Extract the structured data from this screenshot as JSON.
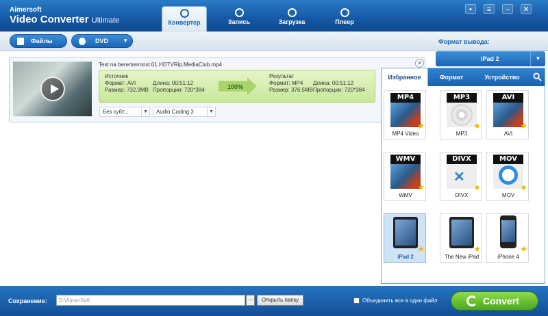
{
  "header": {
    "brand_line1": "Aimersoft",
    "brand_line2": "Video Converter",
    "brand_line2_suffix": "Ultimate",
    "tabs": [
      {
        "label": "Конвертер",
        "icon": "convert-icon",
        "active": true
      },
      {
        "label": "Запись",
        "icon": "burn-icon",
        "active": false
      },
      {
        "label": "Загрузка",
        "icon": "download-icon",
        "active": false
      },
      {
        "label": "Плеер",
        "icon": "play-icon",
        "active": false
      }
    ],
    "window_buttons": {
      "chat": "▪",
      "menu": "≡",
      "minimize": "–",
      "close": "✕"
    }
  },
  "toolbar": {
    "files_label": "Файлы",
    "dvd_label": "DVD",
    "output_format_label": "Формат вывода:"
  },
  "file": {
    "name": "Test na beremennost.01.HDTVRip.MediaClub.mp4",
    "source_title": "Источник",
    "source_format": "Формат: AVI",
    "source_size": "Размер: 732.9MB",
    "source_duration": "Длина: 00:51:12",
    "source_aspect": "Пропорции: 720*384",
    "progress": "100%",
    "result_title": "Результат",
    "result_format": "Формат: MP4",
    "result_size": "Размер: 376.5MB",
    "result_duration": "Длина: 00:51:12",
    "result_aspect": "Пропорции: 720*384",
    "subtitle_option": "Без субт...",
    "audio_option": "Audio Coding 3"
  },
  "format_select": {
    "selected": "iPad 2"
  },
  "format_panel": {
    "tabs": [
      {
        "label": "Избранное",
        "active": true
      },
      {
        "label": "Формат",
        "active": false
      },
      {
        "label": "Устройство",
        "active": false
      }
    ],
    "items": [
      {
        "label": "MP4 Video",
        "tag": "MP4",
        "selected": false
      },
      {
        "label": "MP3",
        "tag": "MP3",
        "selected": false
      },
      {
        "label": "AVI",
        "tag": "AVI",
        "selected": false
      },
      {
        "label": "WMV",
        "tag": "WMV",
        "selected": false
      },
      {
        "label": "DIVX",
        "tag": "DIVX",
        "selected": false
      },
      {
        "label": "MOV",
        "tag": "MOV",
        "selected": false
      },
      {
        "label": "iPad 2",
        "tag": "",
        "selected": true
      },
      {
        "label": "The New iPad",
        "tag": "",
        "selected": false
      },
      {
        "label": "iPhone 4",
        "tag": "",
        "selected": false
      }
    ]
  },
  "bottom": {
    "save_label": "Сохранение:",
    "path_value": "D:\\AimerSoft",
    "browse_label": "···",
    "open_folder_label": "Открыть папку",
    "merge_label": "Объединить все в один файл",
    "convert_label": "Convert"
  },
  "colors": {
    "accent": "#1d64b3",
    "convert": "#5cb82a",
    "info_bg": "#d6eeb0",
    "star": "#f2b600"
  }
}
